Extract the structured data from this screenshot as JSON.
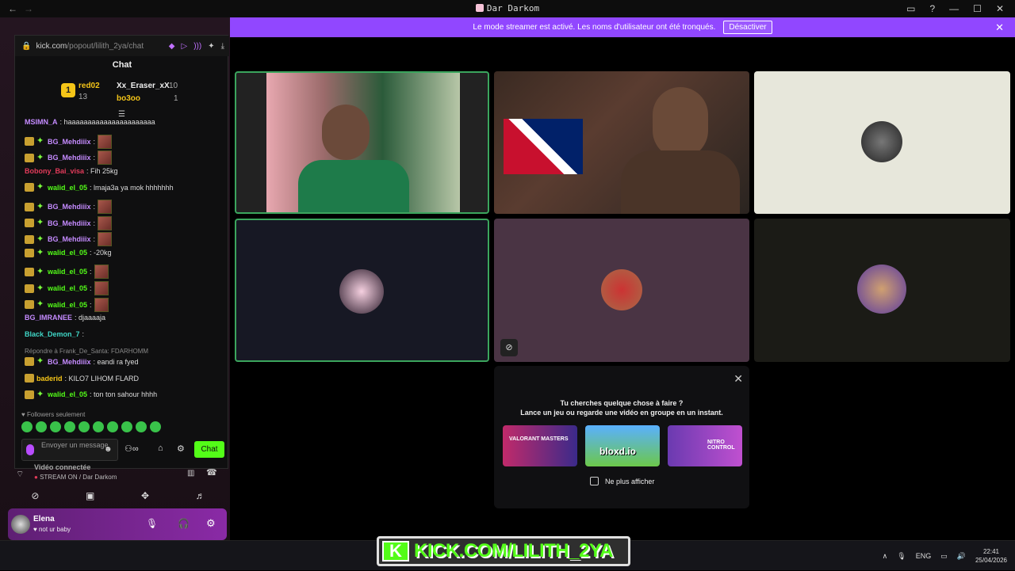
{
  "window": {
    "title": "Dar Darkom",
    "back": "←",
    "forward": "→"
  },
  "banner": {
    "text": "Le mode streamer est activé. Les noms d'utilisateur ont été tronqués.",
    "button": "Désactiver"
  },
  "chat": {
    "url_host": "kick.com",
    "url_path": "/popout/lilith_2ya/chat",
    "title": "Chat",
    "leaderboard": {
      "rank1": "1",
      "first_name": "red02",
      "first_count": "13",
      "second_name": "Xx_Eraser_xX",
      "second_count": "10",
      "third_name": "bo3oo",
      "third_count": "1"
    },
    "messages": [
      {
        "user": "MSIMN_A",
        "color": "#c58bff",
        "text": ": haaaaaaaaaaaaaaaaaaaaaa",
        "badges": false,
        "emote": false
      },
      {
        "user": "BG_Mehdiiix",
        "color": "#c58bff",
        "text": ":",
        "badges": true,
        "emote": true
      },
      {
        "user": "BG_Mehdiiix",
        "color": "#c58bff",
        "text": ":",
        "badges": true,
        "emote": true
      },
      {
        "user": "Bobony_Bai_visa",
        "color": "#e23b5a",
        "text": ": Fih 25kg",
        "badges": false,
        "emote": false
      },
      {
        "user": "walid_el_05",
        "color": "#53fc18",
        "text": ": lmaja3a ya mok hhhhhhh",
        "badges": true,
        "emote": false
      },
      {
        "user": "BG_Mehdiiix",
        "color": "#c58bff",
        "text": ":",
        "badges": true,
        "emote": true
      },
      {
        "user": "BG_Mehdiiix",
        "color": "#c58bff",
        "text": ":",
        "badges": true,
        "emote": true
      },
      {
        "user": "BG_Mehdiiix",
        "color": "#c58bff",
        "text": ":",
        "badges": true,
        "emote": true
      },
      {
        "user": "walid_el_05",
        "color": "#53fc18",
        "text": ": -20kg",
        "badges": true,
        "emote": false
      },
      {
        "user": "walid_el_05",
        "color": "#53fc18",
        "text": ":",
        "badges": true,
        "emote": true
      },
      {
        "user": "walid_el_05",
        "color": "#53fc18",
        "text": ":",
        "badges": true,
        "emote": true
      },
      {
        "user": "walid_el_05",
        "color": "#53fc18",
        "text": ":",
        "badges": true,
        "emote": true
      },
      {
        "user": "BG_IMRANEE",
        "color": "#c58bff",
        "text": ": djaaaaja",
        "badges": false,
        "emote": false
      },
      {
        "user": "Black_Demon_7",
        "color": "#3fd6c6",
        "text": ":",
        "badges": false,
        "emote": false
      }
    ],
    "reply_label": "Répondre à Frank_De_Santa: FDARHOMM",
    "messages2": [
      {
        "user": "BG_Mehdiiix",
        "color": "#c58bff",
        "text": ": eandi ra fyed"
      },
      {
        "user": "baderid",
        "color": "#f5c518",
        "text": ": KILO7 LIHOM FLARD"
      },
      {
        "user": "walid_el_05",
        "color": "#53fc18",
        "text": ": ton ton sahour hhhh"
      }
    ],
    "followers_only": "Followers seulement",
    "input_placeholder": "Envoyer un message",
    "chat_button": "Chat"
  },
  "voice": {
    "title": "Vidéo connectée",
    "status": "STREAM ON / Dar Darkom"
  },
  "user": {
    "name": "Elena",
    "status": "not ur baby"
  },
  "activity": {
    "line1": "Tu cherches quelque chose à faire ?",
    "line2": "Lance un jeu ou regarde une vidéo en groupe en un instant.",
    "card1": "VALORANT MASTERS",
    "card2": "bloxd.io",
    "card3": "NITRO CONTROL",
    "no_show": "Ne plus afficher"
  },
  "overlay": {
    "kick_text": "KICK.COM/LILITH_2YA",
    "kick_logo": "K"
  },
  "tray": {
    "lang": "ENG",
    "time": "22:41",
    "date": "25/04/2026"
  },
  "colors": {
    "brand_purple": "#9147ff",
    "kick_green": "#53fc18",
    "speaking_border": "#3ba55d"
  }
}
